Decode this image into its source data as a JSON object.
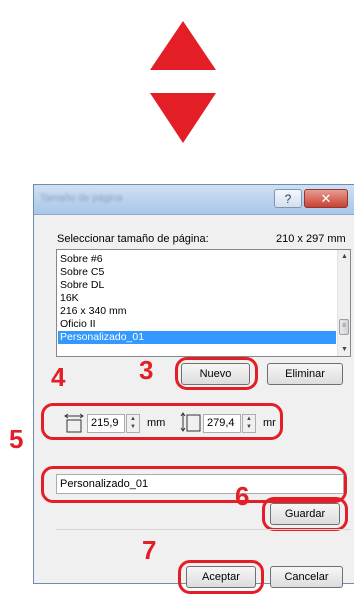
{
  "colors": {
    "highlight": "#e41e26",
    "selection": "#3399ff"
  },
  "indicators": {
    "up_arrow": "arrow-up-icon",
    "down_arrow": "arrow-down-icon"
  },
  "dialog": {
    "title": "Tamaño de página",
    "help_label": "?",
    "close_label": "✕",
    "select_label": "Seleccionar tamaño de página:",
    "current_size": "210 x 297 mm",
    "list_items": [
      "Sobre #6",
      "Sobre C5",
      "Sobre DL",
      "16K",
      "216 x 340 mm",
      "Oficio II",
      "Personalizado_01"
    ],
    "selected_item": "Personalizado_01",
    "new_button": "Nuevo",
    "delete_button": "Eliminar",
    "width_value": "215,9",
    "width_unit": "mm",
    "height_value": "279,4",
    "height_unit": "mr",
    "name_value": "Personalizado_01",
    "save_button": "Guardar",
    "ok_button": "Aceptar",
    "cancel_button": "Cancelar"
  },
  "callouts": {
    "n3": "3",
    "n4": "4",
    "n5": "5",
    "n6": "6",
    "n7": "7"
  }
}
